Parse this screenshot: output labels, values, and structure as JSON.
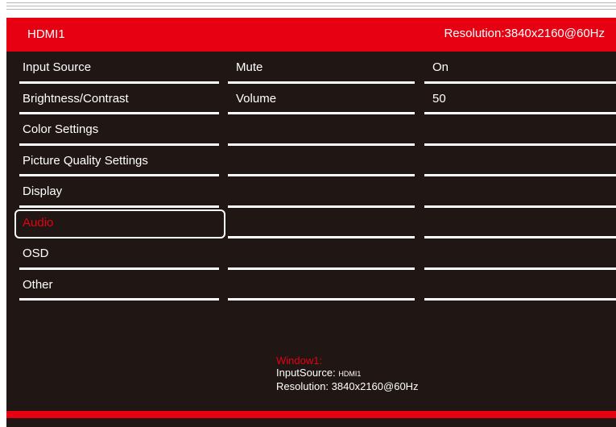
{
  "header": {
    "input_source": "HDMI1",
    "resolution": "Resolution:3840x2160@60Hz"
  },
  "menu": {
    "selected": "Audio",
    "items": [
      {
        "label": "Input Source"
      },
      {
        "label": "Brightness/Contrast"
      },
      {
        "label": "Color Settings"
      },
      {
        "label": "Picture Quality Settings"
      },
      {
        "label": "Display"
      },
      {
        "label": "Audio"
      },
      {
        "label": "OSD"
      },
      {
        "label": "Other"
      }
    ]
  },
  "submenu": {
    "items": [
      {
        "label": "Mute",
        "value": "On"
      },
      {
        "label": "Volume",
        "value": "50"
      }
    ]
  },
  "window_info": {
    "title": "Window1:",
    "input_source_label": "InputSource:",
    "input_source_value": "HDMI1",
    "resolution_label": "Resolution:",
    "resolution_value": "3840x2160@60Hz"
  },
  "colors": {
    "accent": "#e60012",
    "background": "#201614",
    "text": "#ffffff"
  }
}
